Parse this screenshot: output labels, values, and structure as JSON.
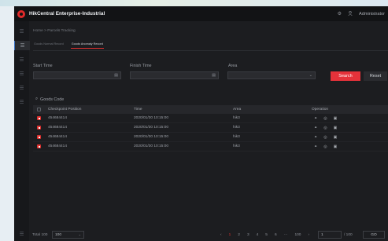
{
  "app": {
    "title": "HikCentral Enterprise-Industrial",
    "user": "Administrator"
  },
  "header_icons": [
    "gear-icon",
    "user-icon"
  ],
  "sidebar": {
    "items": [
      {
        "icon": "menu-icon"
      },
      {
        "icon": "list-icon",
        "active": true
      },
      {
        "icon": "list-icon"
      },
      {
        "icon": "list-icon"
      },
      {
        "icon": "list-icon"
      },
      {
        "icon": "list-icon"
      },
      {
        "icon": "list-icon"
      }
    ],
    "footer_icon": "menu-icon"
  },
  "breadcrumb": "Home > Parcels Tracking",
  "tabs": [
    {
      "label": "Goods Normal Record",
      "active": false
    },
    {
      "label": "Goods Anomaly Record",
      "active": true
    }
  ],
  "filters": {
    "start_label": "Start Time",
    "finish_label": "Finish Time",
    "area_label": "Area",
    "start_value": "",
    "finish_value": "",
    "area_value": "",
    "search_label": "Search",
    "reset_label": "Reset"
  },
  "goods_code_label": "Goods Code",
  "table": {
    "columns": [
      "Checkpoint Position",
      "Time",
      "Area",
      "Operation"
    ],
    "rows": [
      {
        "position": "454684414",
        "time": "2020/01/30 10:15:00",
        "area": "hik3"
      },
      {
        "position": "454684414",
        "time": "2020/01/30 10:15:00",
        "area": "hik3"
      },
      {
        "position": "454684414",
        "time": "2020/01/30 10:15:00",
        "area": "hik3"
      },
      {
        "position": "454684414",
        "time": "2020/01/30 10:15:00",
        "area": "hik3"
      }
    ],
    "operation_icons": [
      "link-icon",
      "target-icon",
      "image-icon"
    ]
  },
  "pagination": {
    "total_label": "Total 100",
    "page_size": "100",
    "pages": [
      "1",
      "2",
      "3",
      "4",
      "5",
      "6",
      "···",
      "100"
    ],
    "current_page": "1",
    "jump_value": "1",
    "total_pages": "/ 100",
    "go_label": "GO"
  },
  "colors": {
    "accent": "#e5323a",
    "background": "#1c1d20",
    "topbar": "#121315"
  }
}
